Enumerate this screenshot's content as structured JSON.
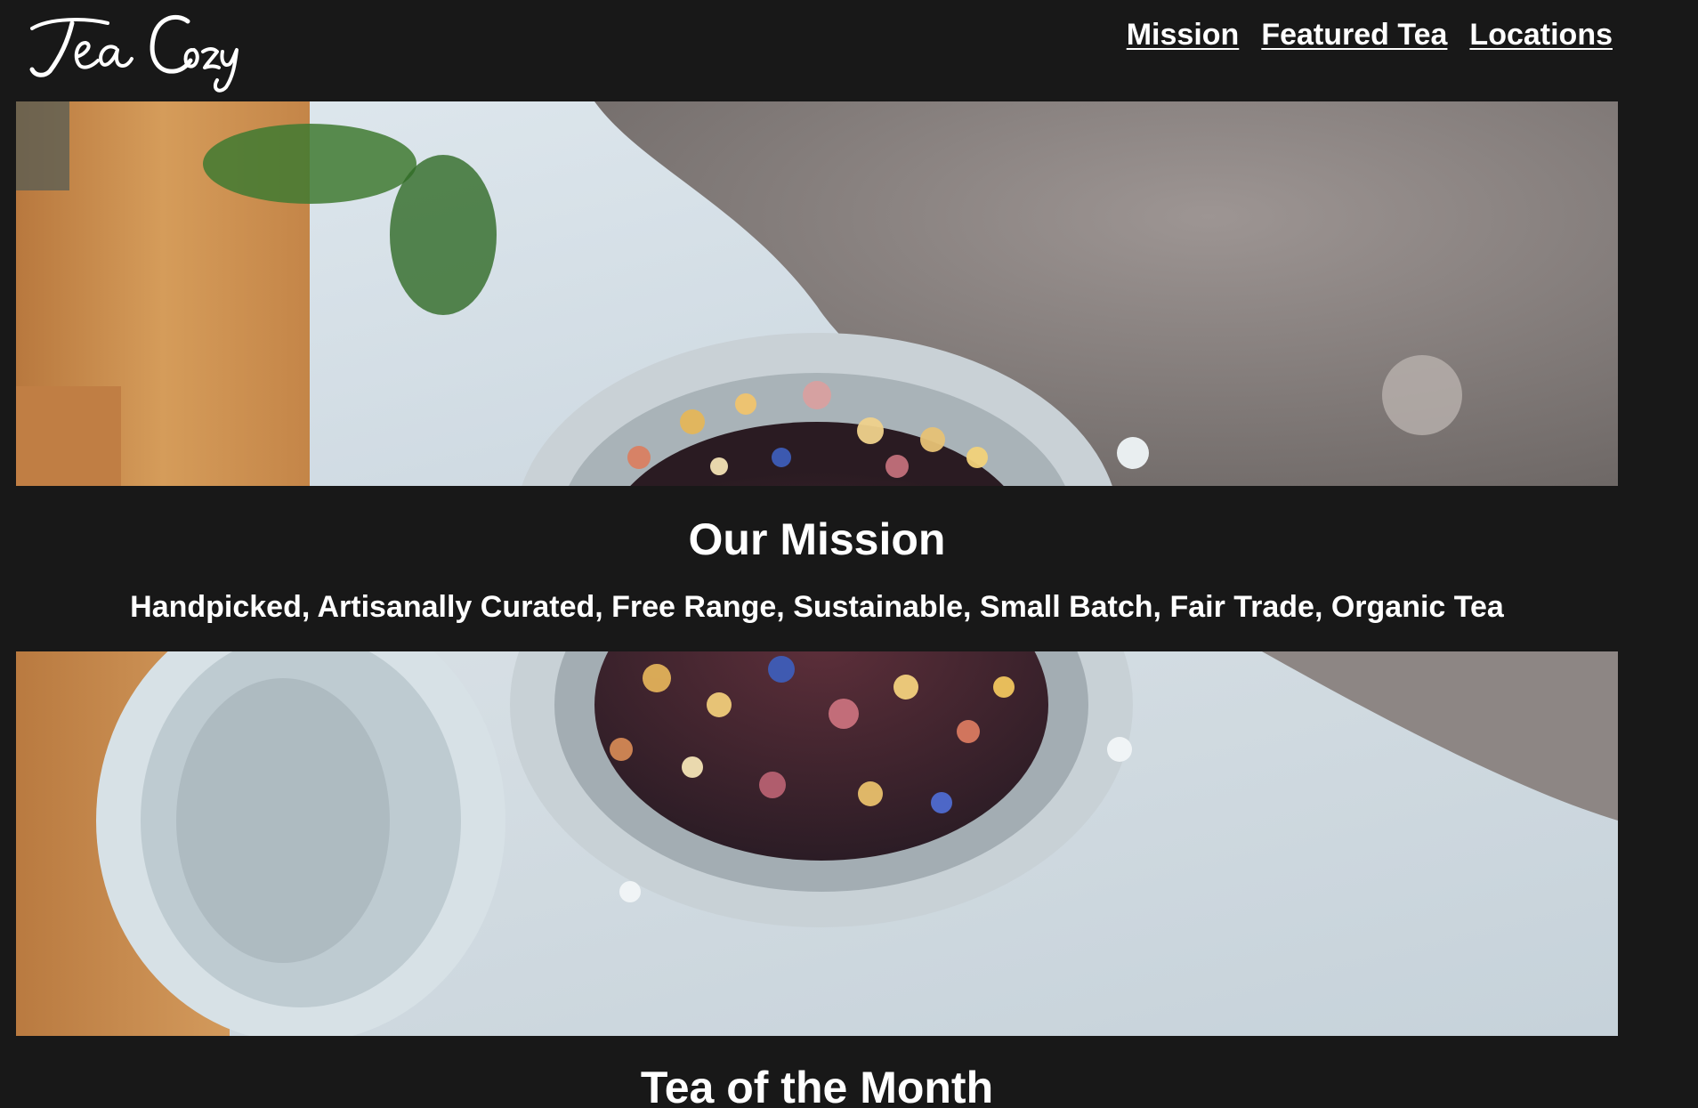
{
  "header": {
    "logo_text": "Tea Cozy",
    "nav": [
      {
        "label": "Mission"
      },
      {
        "label": "Featured Tea"
      },
      {
        "label": "Locations"
      }
    ]
  },
  "mission": {
    "title": "Our Mission",
    "text": "Handpicked, Artisanally Curated, Free Range, Sustainable, Small Batch, Fair Trade, Organic Tea"
  },
  "tea_of_month": {
    "title": "Tea of the Month"
  },
  "colors": {
    "background": "#181818",
    "text": "#ffffff"
  }
}
